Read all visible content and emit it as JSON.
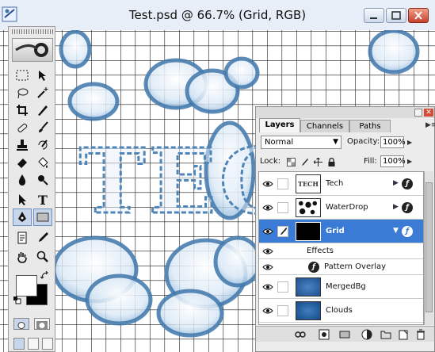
{
  "window": {
    "title": "Test.psd @ 66.7% (Grid, RGB)",
    "icon": "photoshop-document-icon",
    "controls": [
      "minimize-icon",
      "maximize-icon",
      "close-icon"
    ]
  },
  "toolbox": {
    "tools": [
      "marquee-icon",
      "move-icon",
      "lasso-icon",
      "magic-wand-icon",
      "crop-icon",
      "slice-icon",
      "healing-brush-icon",
      "brush-icon",
      "clone-stamp-icon",
      "history-brush-icon",
      "eraser-icon",
      "paint-bucket-icon",
      "blur-icon",
      "dodge-icon",
      "path-selection-icon",
      "type-icon",
      "pen-icon",
      "rectangle-icon",
      "notes-icon",
      "eyedropper-icon",
      "hand-icon",
      "zoom-icon"
    ],
    "selected_tool": "rectangle-icon",
    "colors": {
      "foreground": "#ffffff",
      "background": "#000000"
    }
  },
  "canvas": {
    "artwork_text": "TEC",
    "grid_color": "#1a1a1a",
    "cloud_color": "#3f77aa"
  },
  "layers_panel": {
    "tabs": [
      "Layers",
      "Channels",
      "Paths"
    ],
    "active_tab": "Layers",
    "blend_mode": "Normal",
    "opacity_label": "Opacity:",
    "opacity_value": "100%",
    "lock_label": "Lock:",
    "fill_label": "Fill:",
    "fill_value": "100%",
    "layers": [
      {
        "name": "Tech",
        "thumb_text": "TECH",
        "has_effects": true,
        "selected": false
      },
      {
        "name": "WaterDrop",
        "has_effects": true,
        "selected": false
      },
      {
        "name": "Grid",
        "has_effects": true,
        "selected": true,
        "effects_label": "Effects",
        "effect_item": "Pattern Overlay"
      },
      {
        "name": "MergedBg",
        "has_effects": false,
        "selected": false
      },
      {
        "name": "Clouds",
        "has_effects": false,
        "selected": false
      }
    ],
    "bottom_icons": [
      "link-layers-icon",
      "add-style-icon",
      "add-mask-icon",
      "new-fill-layer-icon",
      "new-group-icon",
      "new-layer-icon",
      "trash-icon"
    ]
  }
}
